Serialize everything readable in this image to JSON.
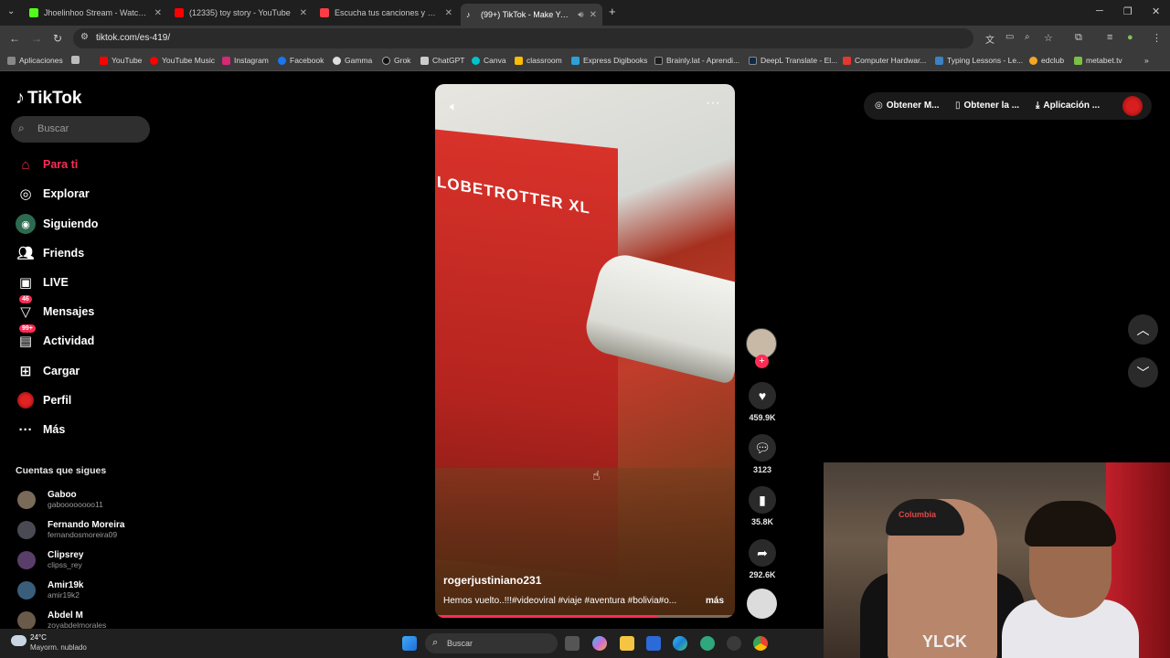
{
  "browser": {
    "tabs": [
      {
        "title": "Jhoelinhoo Stream - Watch Live",
        "favicon_color": "#53fc18"
      },
      {
        "title": "(12335) toy story - YouTube",
        "favicon_color": "#ff0000"
      },
      {
        "title": "Escucha tus canciones y álbumes",
        "favicon_color": "#fc3c44"
      },
      {
        "title": "(99+) TikTok - Make Your D...",
        "favicon_color": "#ffffff"
      }
    ],
    "url": "tiktok.com/es-419/",
    "bookmarks": [
      {
        "label": "Aplicaciones"
      },
      {
        "label": "YouTube"
      },
      {
        "label": "YouTube Music"
      },
      {
        "label": "Instagram"
      },
      {
        "label": "Facebook"
      },
      {
        "label": "Gamma"
      },
      {
        "label": "Grok"
      },
      {
        "label": "ChatGPT"
      },
      {
        "label": "Canva"
      },
      {
        "label": "classroom"
      },
      {
        "label": "Express Digibooks"
      },
      {
        "label": "Brainly.lat - Aprendi..."
      },
      {
        "label": "DeepL Translate - El..."
      },
      {
        "label": "Computer Hardwar..."
      },
      {
        "label": "Typing Lessons - Le..."
      },
      {
        "label": "edclub"
      },
      {
        "label": "metabet.tv"
      }
    ]
  },
  "tiktok": {
    "logo": "TikTok",
    "search_placeholder": "Buscar",
    "nav": [
      {
        "label": "Para ti",
        "icon": "home-icon",
        "active": true
      },
      {
        "label": "Explorar",
        "icon": "compass-icon"
      },
      {
        "label": "Siguiendo",
        "icon": "following-icon"
      },
      {
        "label": "Friends",
        "icon": "friends-icon"
      },
      {
        "label": "LIVE",
        "icon": "live-icon"
      },
      {
        "label": "Mensajes",
        "icon": "messages-icon",
        "badge": "46"
      },
      {
        "label": "Actividad",
        "icon": "activity-icon",
        "badge": "99+"
      },
      {
        "label": "Cargar",
        "icon": "upload-icon"
      },
      {
        "label": "Perfil",
        "icon": "profile-icon"
      },
      {
        "label": "Más",
        "icon": "more-icon"
      }
    ],
    "following_title": "Cuentas que sigues",
    "following": [
      {
        "name": "Gaboo",
        "handle": "gaboooooooo11"
      },
      {
        "name": "Fernando Moreira",
        "handle": "fernandosmoreira09"
      },
      {
        "name": "Clipsrey",
        "handle": "clipss_rey"
      },
      {
        "name": "Amir19k",
        "handle": "amir19k2"
      },
      {
        "name": "Abdel M",
        "handle": "zoyabdelmorales"
      }
    ],
    "video": {
      "brand_text": "LOBETROTTER XL",
      "author": "rogerjustiniano231",
      "caption": "Hemos vuelto..!!!#videoviral #viaje #aventura #bolivia#o...",
      "more": "más",
      "progress": 0.74
    },
    "actions": {
      "likes": "459.9K",
      "comments": "3123",
      "saves": "35.8K",
      "shares": "292.6K"
    },
    "promo": [
      {
        "label": "Obtener M...",
        "icon": "coin-icon"
      },
      {
        "label": "Obtener la ...",
        "icon": "phone-icon"
      },
      {
        "label": "Aplicación ...",
        "icon": "download-icon"
      }
    ]
  },
  "webcam": {
    "cap_text": "Columbia",
    "shirt_text": "YLCK"
  },
  "taskbar": {
    "temperature": "24°C",
    "weather": "Mayorm. nublado",
    "search_placeholder": "Buscar"
  }
}
